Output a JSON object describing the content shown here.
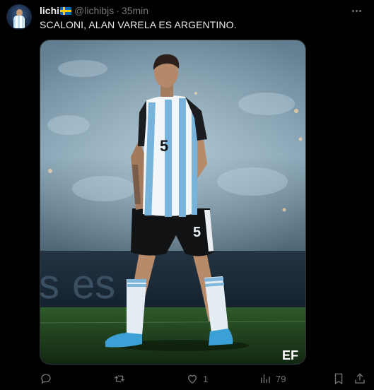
{
  "tweet": {
    "author_name": "lichi",
    "author_flag": "sweden-flag-emoji",
    "handle": "@lichibjs",
    "separator": "·",
    "time": "35min",
    "text": "SCALONI, ALAN VARELA ES ARGENTINO.",
    "jersey_number": "5",
    "watermark": "EF",
    "stadium_ad_text": "es"
  },
  "actions": {
    "reply_count": "",
    "retweet_count": "",
    "like_count": "1",
    "views_count": "79"
  },
  "icons": [
    "more-icon",
    "reply-icon",
    "retweet-icon",
    "like-icon",
    "views-icon",
    "bookmark-icon",
    "share-icon"
  ],
  "colors": {
    "background": "#000000",
    "text_primary": "#e7e9ea",
    "text_secondary": "#71767b",
    "border": "#2f3336"
  }
}
